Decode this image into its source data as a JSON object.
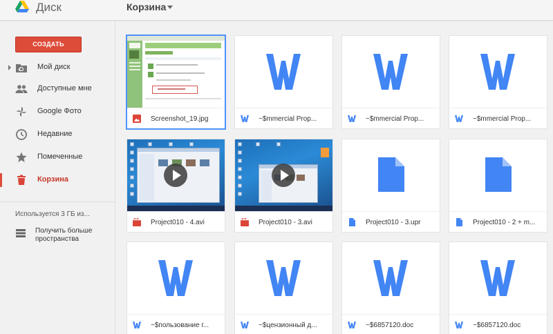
{
  "app": {
    "title": "Диск",
    "location": "Корзина",
    "colors": {
      "accent": "#dd4b39",
      "word_blue": "#4285f4",
      "video_red": "#db4437"
    }
  },
  "sidebar": {
    "create_label": "СОЗДАТЬ",
    "items": [
      {
        "label": "Мой диск",
        "icon": "drive-folder-icon"
      },
      {
        "label": "Доступные мне",
        "icon": "people-icon"
      },
      {
        "label": "Google Фото",
        "icon": "photos-pinwheel-icon"
      },
      {
        "label": "Недавние",
        "icon": "clock-icon"
      },
      {
        "label": "Помеченные",
        "icon": "star-icon"
      },
      {
        "label": "Корзина",
        "icon": "trash-icon",
        "active": true
      }
    ],
    "storage_text": "Используется 3 ГБ из...",
    "more_storage_label": "Получить больше пространства"
  },
  "files": [
    {
      "name": "Screenshot_19.jpg",
      "type": "image",
      "selected": true
    },
    {
      "name": "~$mmercial Prop...",
      "type": "word"
    },
    {
      "name": "~$mmercial Prop...",
      "type": "word"
    },
    {
      "name": "~$mmercial Prop...",
      "type": "word"
    },
    {
      "name": "Project010 - 4.avi",
      "type": "video"
    },
    {
      "name": "Project010 - 3.avi",
      "type": "video"
    },
    {
      "name": "Project010 - 3.upr",
      "type": "doc"
    },
    {
      "name": "Project010 - 2 + m...",
      "type": "doc"
    },
    {
      "name": "~$пользование г...",
      "type": "word"
    },
    {
      "name": "~$цензионный д...",
      "type": "word"
    },
    {
      "name": "~$6857120.doc",
      "type": "word"
    },
    {
      "name": "~$6857120.doc",
      "type": "word"
    }
  ]
}
